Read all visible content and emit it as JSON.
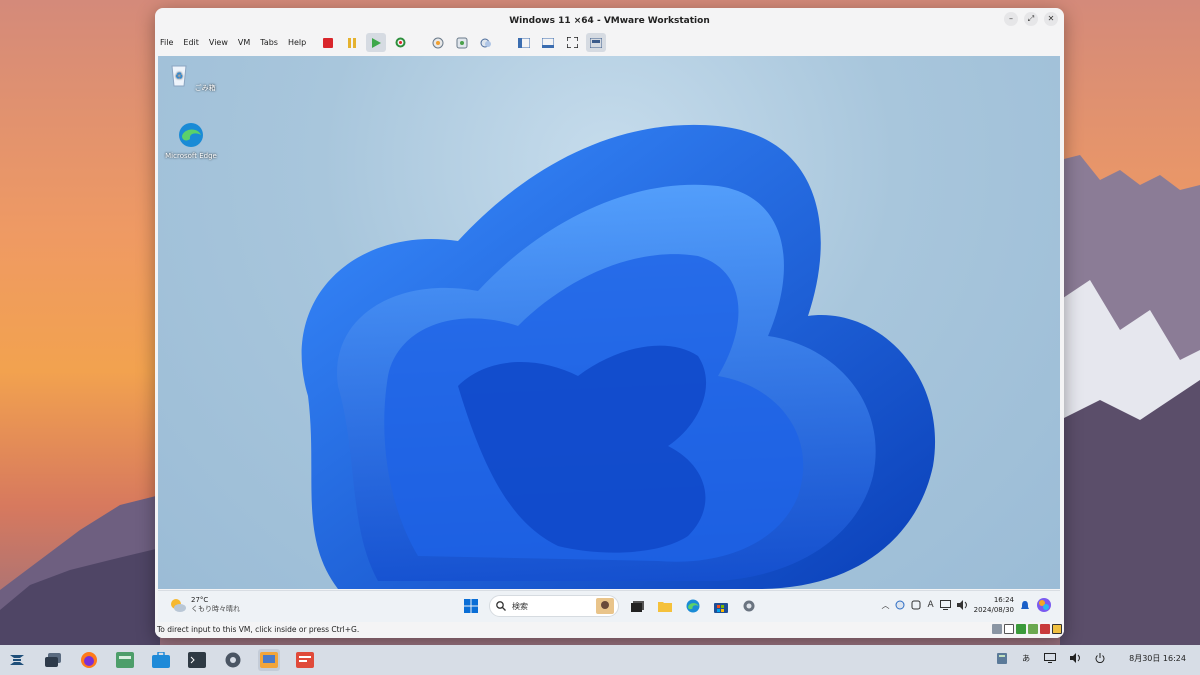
{
  "vm_window": {
    "title": "Windows 11 ×64 - VMware Workstation",
    "menu": [
      "File",
      "Edit",
      "View",
      "VM",
      "Tabs",
      "Help"
    ],
    "status_text": "To direct input to this VM, click inside or press Ctrl+G."
  },
  "guest_desktop": {
    "icons": [
      {
        "label": "ごみ箱",
        "icon": "recycle-bin-icon"
      },
      {
        "label": "Microsoft Edge",
        "icon": "edge-icon"
      }
    ],
    "taskbar": {
      "weather_temp": "27°C",
      "weather_desc": "くもり時々晴れ",
      "search_placeholder": "検索",
      "clock_time": "16:24",
      "clock_date": "2024/08/30",
      "ime": "A"
    }
  },
  "host_panel": {
    "ime": "あ",
    "datetime": "8月30日  16:24"
  },
  "colors": {
    "accent": "#1f5bd6",
    "host_panel": "#d7dde6"
  }
}
